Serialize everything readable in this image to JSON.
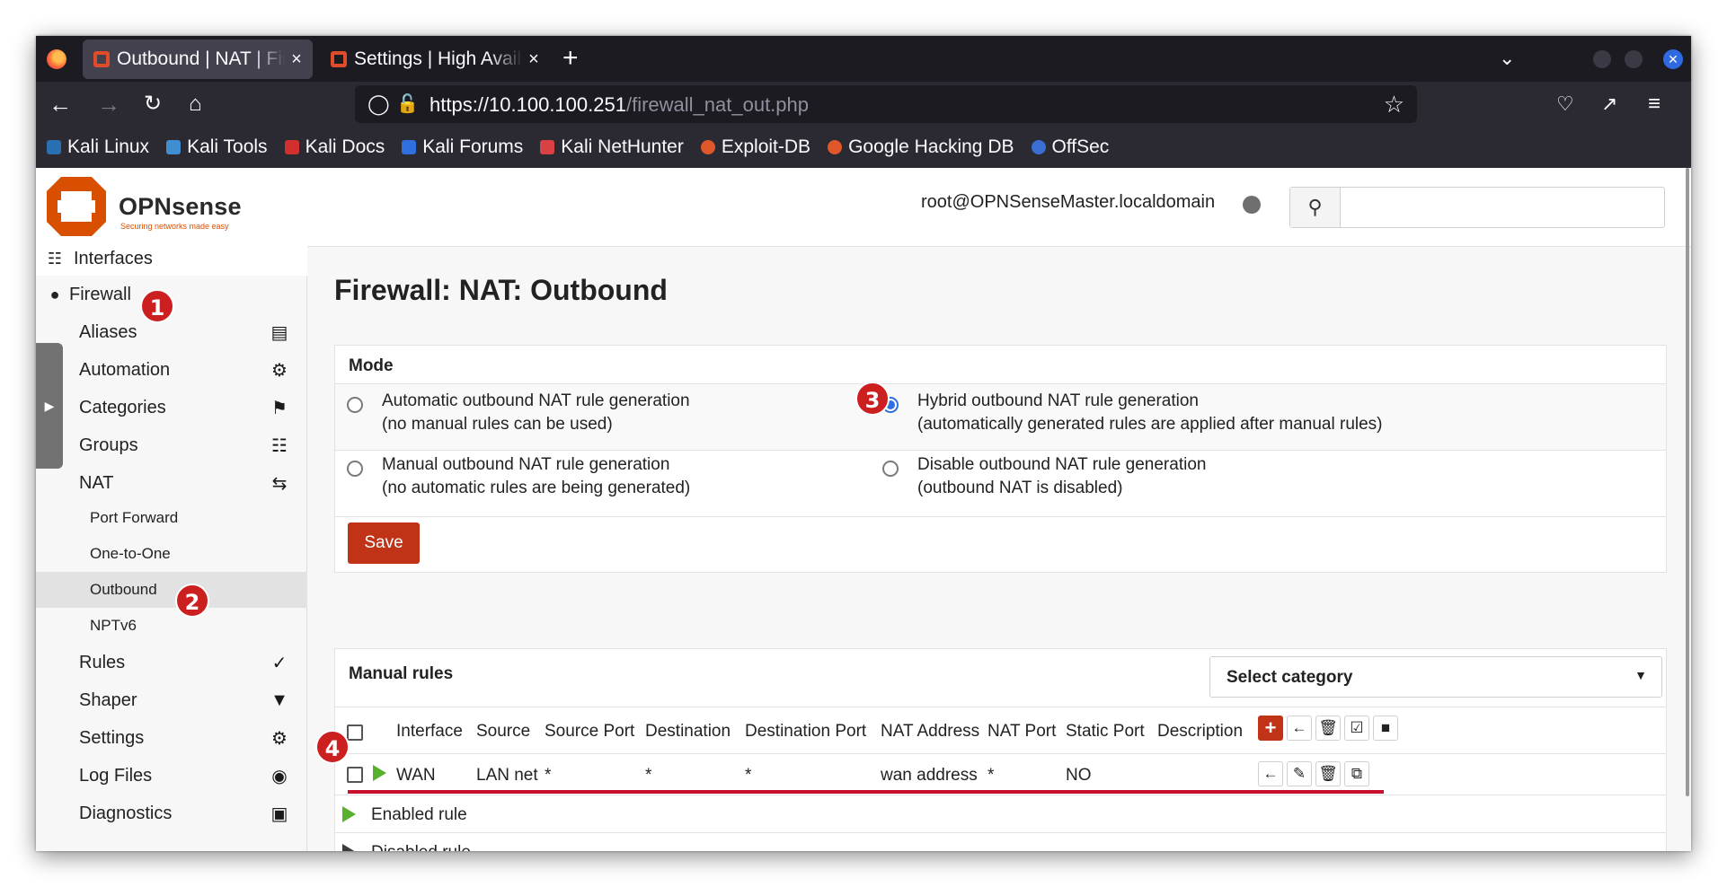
{
  "browser": {
    "tabs": [
      {
        "title": "Outbound | NAT | Firewall",
        "close": "×"
      },
      {
        "title": "Settings | High Availability",
        "close": "×"
      }
    ],
    "new_tab": "+",
    "url_host": "https://10.100.100.251",
    "url_path": "/firewall_nat_out.php",
    "bookmarks": [
      "Kali Linux",
      "Kali Tools",
      "Kali Docs",
      "Kali Forums",
      "Kali NetHunter",
      "Exploit-DB",
      "Google Hacking DB",
      "OffSec"
    ]
  },
  "header": {
    "brand": "OPNsense",
    "tagline": "Securing networks made easy",
    "user": "root@OPNSenseMaster.localdomain"
  },
  "sidebar": {
    "interfaces": "Interfaces",
    "firewall": "Firewall",
    "items": [
      {
        "label": "Aliases"
      },
      {
        "label": "Automation"
      },
      {
        "label": "Categories"
      },
      {
        "label": "Groups"
      },
      {
        "label": "NAT"
      }
    ],
    "nat_sub": [
      "Port Forward",
      "One-to-One",
      "Outbound",
      "NPTv6"
    ],
    "items2": [
      {
        "label": "Rules"
      },
      {
        "label": "Shaper"
      },
      {
        "label": "Settings"
      },
      {
        "label": "Log Files"
      },
      {
        "label": "Diagnostics"
      }
    ]
  },
  "main": {
    "title": "Firewall: NAT: Outbound",
    "mode": {
      "heading": "Mode",
      "options": [
        {
          "line1": "Automatic outbound NAT rule generation",
          "line2": "(no manual rules can be used)",
          "checked": false
        },
        {
          "line1": "Hybrid outbound NAT rule generation",
          "line2": "(automatically generated rules are applied after manual rules)",
          "checked": true
        },
        {
          "line1": "Manual outbound NAT rule generation",
          "line2": "(no automatic rules are being generated)",
          "checked": false
        },
        {
          "line1": "Disable outbound NAT rule generation",
          "line2": "(outbound NAT is disabled)",
          "checked": false
        }
      ],
      "save_label": "Save"
    },
    "manual_rules": {
      "heading": "Manual rules",
      "select_category": "Select category",
      "columns": [
        "Interface",
        "Source",
        "Source Port",
        "Destination",
        "Destination Port",
        "NAT Address",
        "NAT Port",
        "Static Port",
        "Description"
      ],
      "rows": [
        {
          "interface": "WAN",
          "source": "LAN net",
          "source_port": "*",
          "destination": "*",
          "destination_port": "*",
          "nat_address": "wan address",
          "nat_port": "*",
          "static_port": "NO",
          "description": ""
        }
      ],
      "legend": [
        "Enabled rule",
        "Disabled rule"
      ]
    }
  },
  "annotations": [
    "1",
    "2",
    "3",
    "4"
  ],
  "colors": {
    "accent": "#c03317",
    "annotation": "#cc1f1f",
    "radio": "#2f6fe0",
    "enabled": "#58b12e"
  }
}
